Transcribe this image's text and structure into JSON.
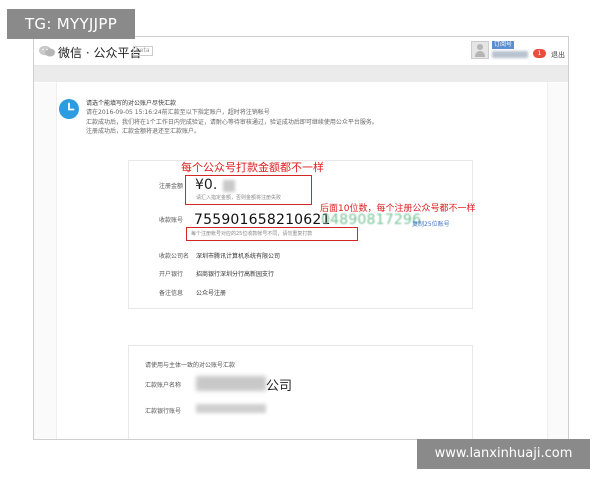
{
  "overlay": {
    "tg_label": "TG: MYYJJPP",
    "watermark": "www.lanxinhuaji.com"
  },
  "header": {
    "brand": "微信 · 公众平台",
    "brand_tag": "beta",
    "account_badge": "订阅号",
    "notice_count": "1",
    "logout": "退出"
  },
  "notice": {
    "title": "请选个能填写的对公账户尽快汇款",
    "line1": "请在2016-09-05 15:16:24前汇款至以下指定账户，超时将注销帐号",
    "line2": "汇款成功后，我们将在1个工作日内完成验证，请耐心等待审核通过，验证成功后即可继续使用公众平台服务。",
    "line3": "注册成功后，汇款金额将退还至汇款账户。"
  },
  "annotations": {
    "amount_note": "每个公众号打款金额都不一样",
    "account_note": "后面10位数，每个注册公众号都不一样"
  },
  "form": {
    "amount_label": "注册金额",
    "amount_value": "¥0.",
    "amount_hint": "请汇入指定金额，否则金额将注册失败",
    "account_label": "收款账号",
    "account_prefix": "755901658210621",
    "account_suffix": "04890817296",
    "account_warning": "每个注册帐号对应的25位收款帐号不同，请勿重复打款",
    "copy_link": "复制25位账号",
    "company_label": "收款公司名",
    "company_value": "深圳市腾讯计算机系统有限公司",
    "bank_label": "开户银行",
    "bank_value": "招商银行深圳分行高新园支行",
    "memo_label": "备注信息",
    "memo_value": "公众号注册"
  },
  "payer": {
    "heading": "请使用与主体一致的对公账号汇款",
    "name_label": "汇款账户名称",
    "name_suffix": "公司",
    "bank_acc_label": "汇款银行账号"
  },
  "colors": {
    "annotation_red": "#e01e1e",
    "link_blue": "#3b74c8",
    "clock_blue": "#2d9bdf"
  }
}
